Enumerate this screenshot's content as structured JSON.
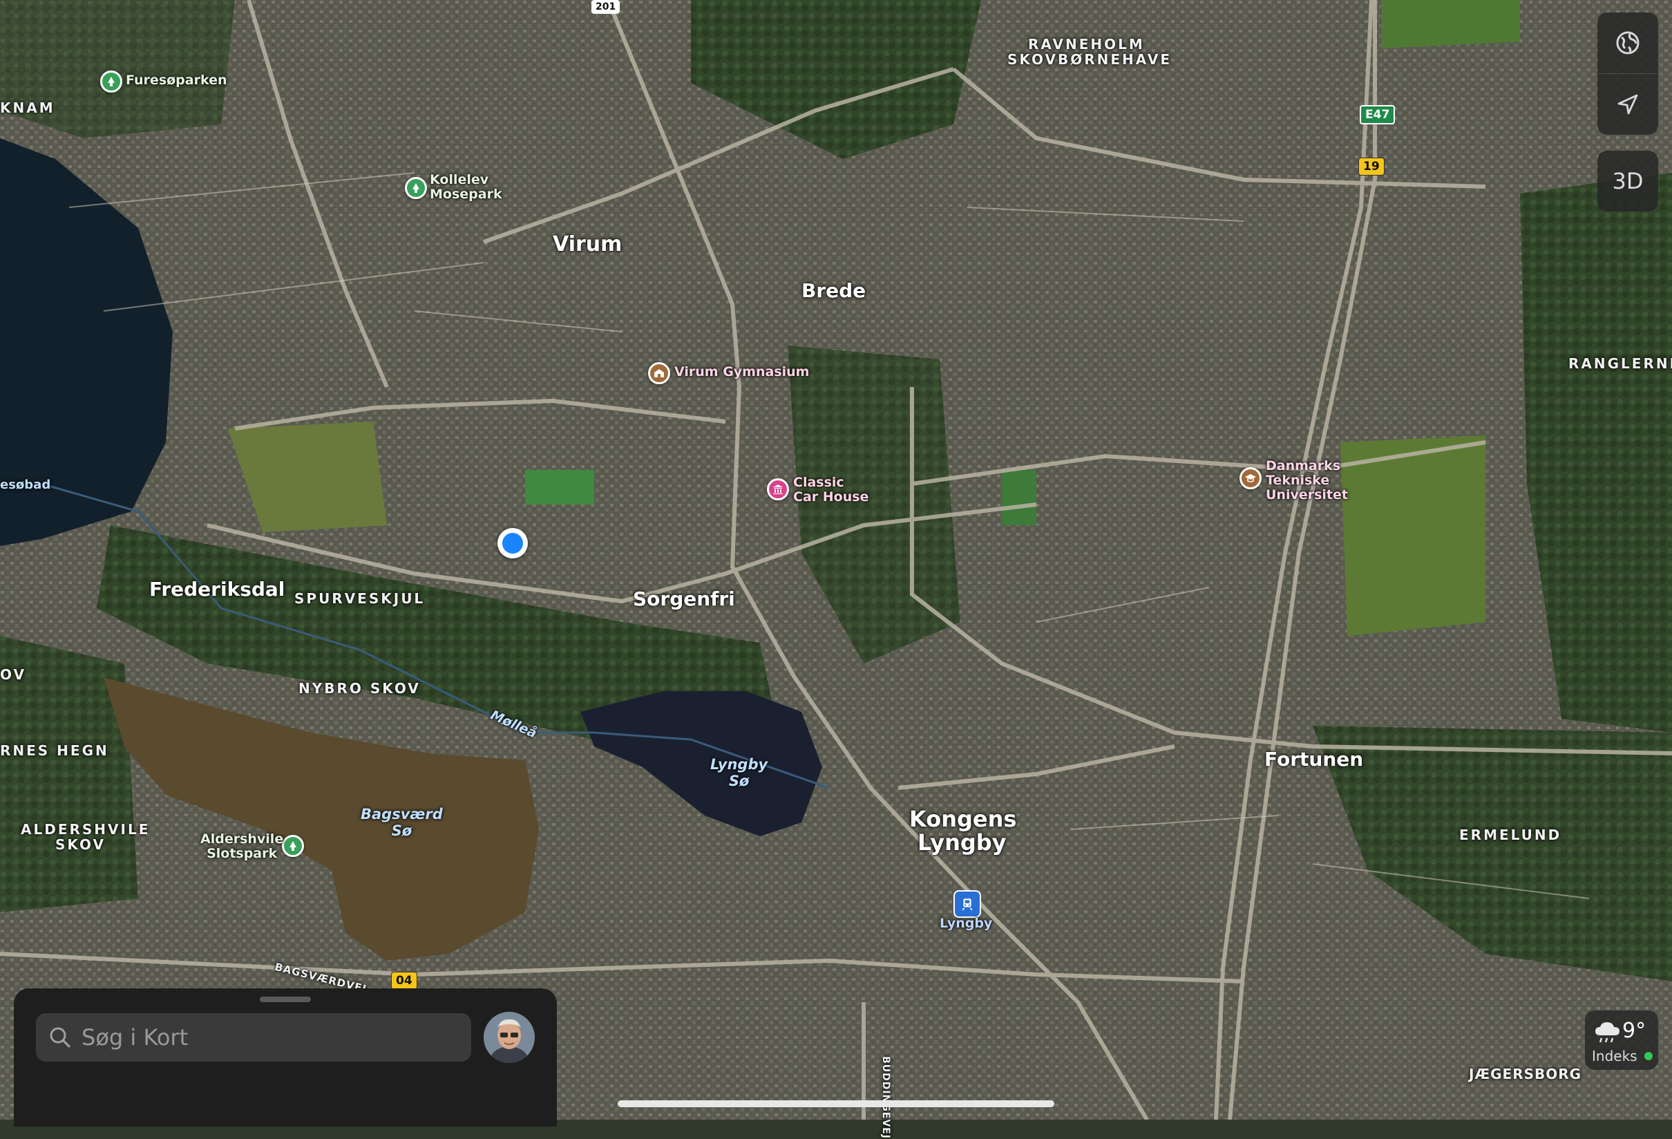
{
  "map": {
    "towns": {
      "virum": "Virum",
      "brede": "Brede",
      "sorgenfri": "Sorgenfri",
      "frederiksdal": "Frederiksdal",
      "kongens_lyngby_1": "Kongens",
      "kongens_lyngby_2": "Lyngby",
      "fortunen": "Fortunen"
    },
    "areas": {
      "ravneholm_1": "RAVNEHOLM",
      "ravneholm_2": "SKOVBØRNEHAVE",
      "spurveskjul": "SPURVESKJUL",
      "nybro_skov": "NYBRO SKOV",
      "rnes_hegn": "RNES HEGN",
      "aldershvile_skov_1": "ALDERSHVILE",
      "aldershvile_skov_2": "SKOV",
      "ranglerne": "RANGLERNE",
      "ermelund": "ERMELUND",
      "jaegersborg": "JÆGERSBORG",
      "knam": "KNAM",
      "ov": "OV"
    },
    "water": {
      "lyngby_so_1": "Lyngby",
      "lyngby_so_2": "Sø",
      "bagsvaerd_so_1": "Bagsværd",
      "bagsvaerd_so_2": "Sø",
      "molle_a": "Mølleå",
      "esobad": "esøbad"
    },
    "pois": {
      "furesoparken": "Furesøparken",
      "kollelev_1": "Kollelev",
      "kollelev_2": "Mosepark",
      "virum_gymnasium": "Virum Gymnasium",
      "classic_1": "Classic",
      "classic_2": "Car House",
      "dtu_1": "Danmarks",
      "dtu_2": "Tekniske",
      "dtu_3": "Universitet",
      "aldershvile_1": "Aldershvile",
      "aldershvile_2": "Slotspark",
      "lyngby_station": "Lyngby"
    },
    "roads": {
      "bagsvaerdvej": "BAGSVÆRDVEJ",
      "buddingevej": "BUDDINGEVEJ",
      "e47": "E47",
      "r19": "19",
      "r04": "04",
      "r201": "201"
    }
  },
  "controls": {
    "globe_icon": "globe-icon",
    "location_icon": "location-arrow-icon",
    "three_d": "3D"
  },
  "weather": {
    "temp": "9°",
    "index_label": "Indeks",
    "icon": "cloud-rain-icon",
    "index_color": "#34c759"
  },
  "sheet": {
    "search_placeholder": "Søg i Kort"
  }
}
